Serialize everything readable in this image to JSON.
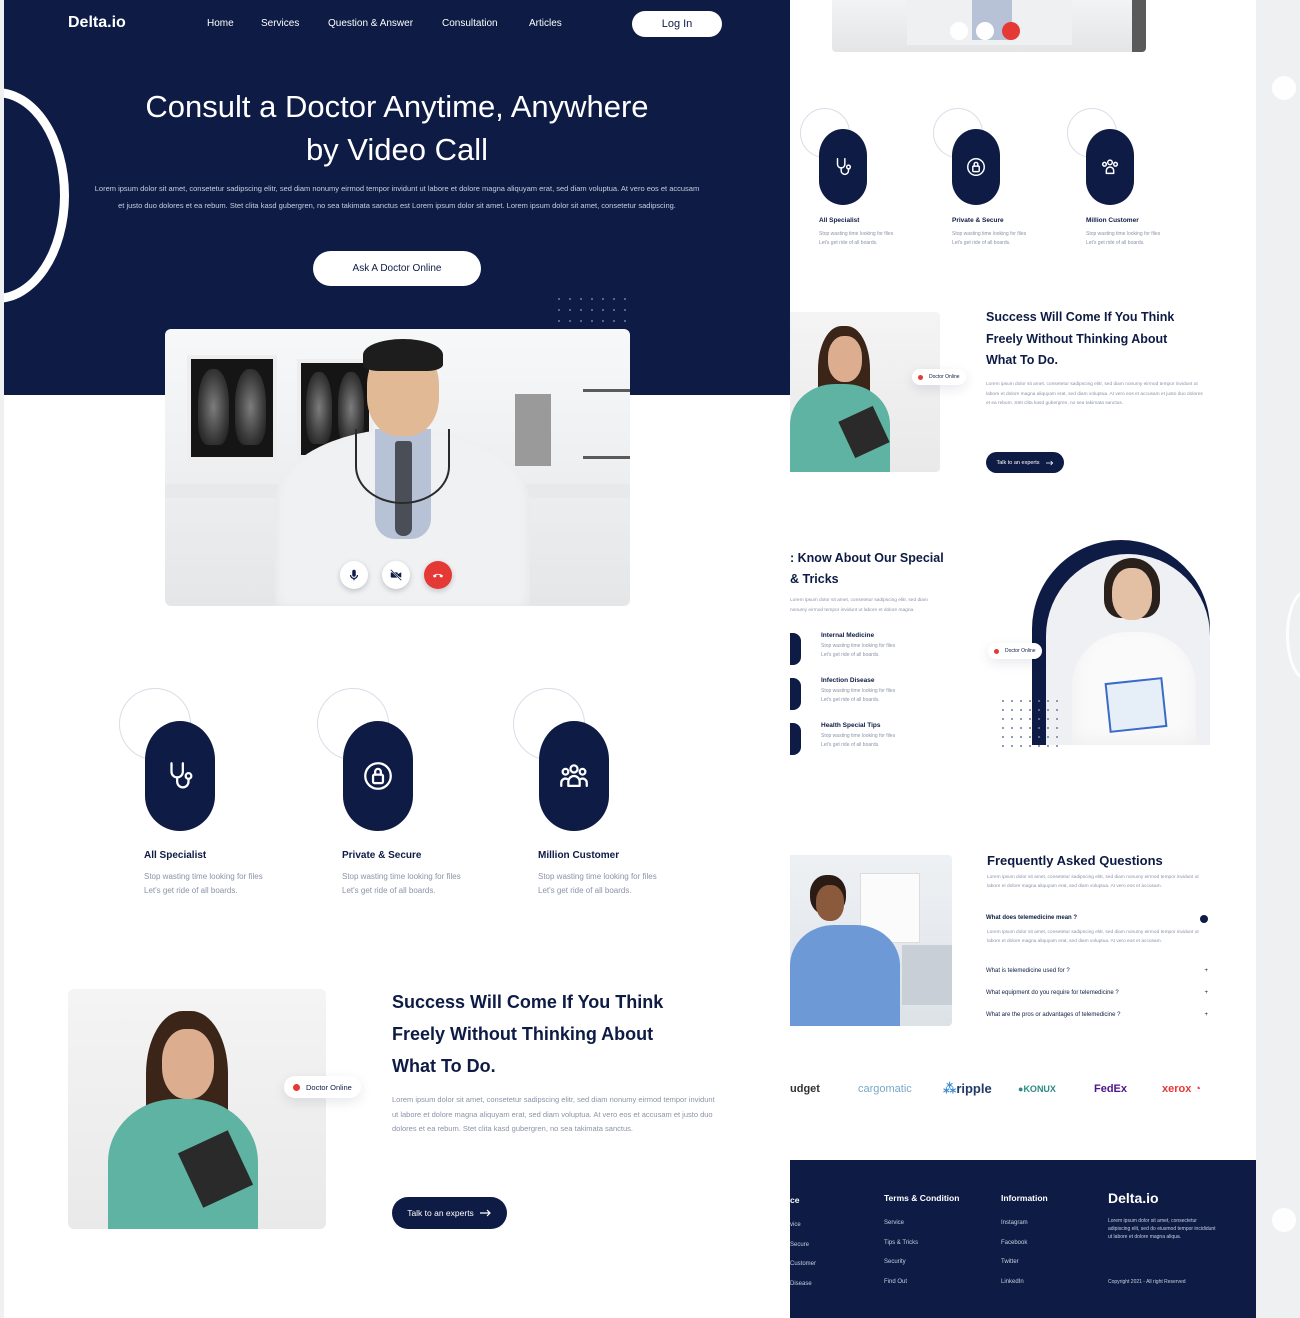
{
  "brand": {
    "logo": "Delta.io",
    "navy": "#0d1b45",
    "accent_red": "#e53935"
  },
  "nav": {
    "items": [
      "Home",
      "Services",
      "Question & Answer",
      "Consultation",
      "Articles"
    ],
    "login": "Log In"
  },
  "hero": {
    "title_line1": "Consult a Doctor Anytime, Anywhere",
    "title_line2": "by Video Call",
    "desc": "Lorem ipsum dolor sit amet, consetetur sadipscing elitr, sed diam nonumy eirmod tempor invidunt ut labore et dolore magna aliquyam erat, sed diam voluptua. At vero eos et accusam et justo duo dolores et ea rebum. Stet clita kasd gubergren, no sea takimata sanctus est Lorem ipsum dolor sit amet. Lorem ipsum dolor sit amet, consetetur sadipscing.",
    "cta": "Ask A Doctor Online"
  },
  "call_controls": [
    "mic-icon",
    "video-off-icon",
    "hang-up-icon"
  ],
  "features": [
    {
      "title": "All Specialist",
      "desc1": "Stop wasting time looking for files",
      "desc2": "Let's get ride of all boards.",
      "icon": "stethoscope-icon"
    },
    {
      "title": "Private & Secure",
      "desc1": "Stop wasting time looking for files",
      "desc2": "Let's get ride of all boards.",
      "icon": "lock-icon"
    },
    {
      "title": "Million Customer",
      "desc1": "Stop wasting time looking for files",
      "desc2": "Let's get ride of all boards.",
      "icon": "users-icon"
    }
  ],
  "success": {
    "title_line1": "Success Will Come If You Think",
    "title_line2": "Freely Without Thinking About",
    "title_line3": "What To Do.",
    "desc": "Lorem ipsum dolor sit amet, consetetur sadipscing elitr, sed diam nonumy eirmod tempor invidunt ut labore et dolore magna aliquyam erat, sed diam voluptua. At vero eos et accusam et justo duo dolores et ea rebum. Stet clita kasd gubergren, no sea takimata sanctus.",
    "badge": "Doctor Online",
    "cta": "Talk to an experts"
  },
  "tips": {
    "title_line1": "Know About Our Special",
    "title_line2": "& Tricks",
    "desc1": "Lorem ipsum dolor sit amet, consetetur sadipscing elitr, sed diam",
    "desc2": "nonumy eirmod tempor invidunt ut labore et dolore magna.",
    "items": [
      {
        "title": "Internal Medicine",
        "desc1": "Stop wasting time looking for files",
        "desc2": "Let's get ride of all boards."
      },
      {
        "title": "Infection Disease",
        "desc1": "Stop wasting time looking for files",
        "desc2": "Let's get ride of all boards."
      },
      {
        "title": "Health Special Tips",
        "desc1": "Stop wasting time looking for files",
        "desc2": "Let's get ride of all boards."
      }
    ],
    "badge": "Doctor Online"
  },
  "faq": {
    "title": "Frequently Asked Questions",
    "intro": "Lorem ipsum dolor sit amet, consetetur sadipscing elitr, sed diam nonumy eirmod tempor invidunt ut labore et dolore magna aliquyam erat, sed diam voluptua. At vero eos et accusam.",
    "open_question": "What does telemedicine mean ?",
    "open_answer": "Lorem ipsum dolor sit amet, consetetur sadipscing elitr, sed diam nonumy eirmod tempor invidunt ut labore et dolore magna aliquyam erat, sed diam voluptua. At vero eos et accusam.",
    "questions": [
      "What is telemedicine used for ?",
      "What equipment do you require for telemedicine ?",
      "What are the pros or advantages of telemedicine ?"
    ]
  },
  "partners": [
    "udget",
    "cargomatic",
    "ripple",
    "KONUX",
    "FedEx",
    "xerox"
  ],
  "footer": {
    "col1_head": "ce",
    "col1": [
      "vice",
      "Secure",
      "Customer",
      "Disease"
    ],
    "col2_head": "Terms & Condition",
    "col2": [
      "Service",
      "Tips & Tricks",
      "Security",
      "Find Out"
    ],
    "col3_head": "Information",
    "col3": [
      "Instagram",
      "Facebook",
      "Twitter",
      "LinkedIn"
    ],
    "brand": "Delta.io",
    "about": "Lorem ipsum dolor sit amet, consectetur adipiscing elit, sed do eiusmod tempor incididunt ut labore et dolore magna aliqua.",
    "copyright": "Copyright 2021 - All right Reserved"
  }
}
